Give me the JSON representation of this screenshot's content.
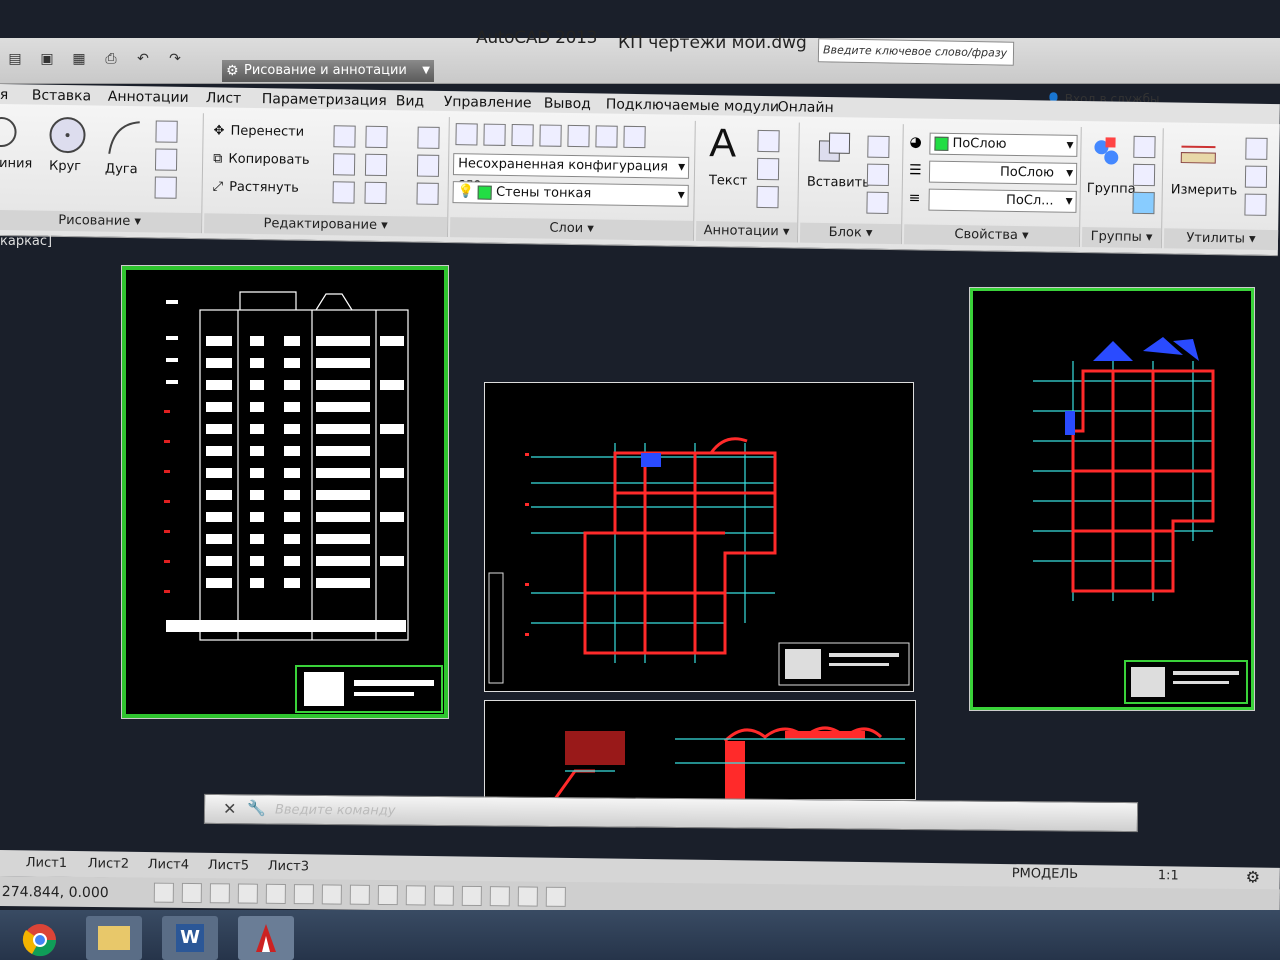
{
  "window": {
    "app_title": "AutoCAD 2013",
    "file_title": "КП чертежи мои.dwg",
    "workspace": "Рисование и аннотации",
    "search_placeholder": "Введите ключевое слово/фразу",
    "signin": "Вход в службы"
  },
  "tabs": [
    "я",
    "Вставка",
    "Аннотации",
    "Лист",
    "Параметризация",
    "Вид",
    "Управление",
    "Вывод",
    "Подключаемые модули",
    "Онлайн"
  ],
  "ribbon": {
    "draw": {
      "title": "Рисование",
      "line": "иния",
      "circle": "Круг",
      "arc": "Дуга"
    },
    "modify": {
      "title": "Редактирование",
      "move": "Перенести",
      "copy": "Копировать",
      "stretch": "Растянуть"
    },
    "layers": {
      "title": "Слои",
      "layer_state": "Несохраненная конфигурация сло",
      "current_layer": "Стены тонкая"
    },
    "annotation": {
      "title": "Аннотации",
      "text": "Текст"
    },
    "block": {
      "title": "Блок",
      "insert": "Вставить"
    },
    "properties": {
      "title": "Свойства",
      "color": "ПоСлою",
      "linetype": "ПоСлою",
      "lineweight": "ПоСл..."
    },
    "groups": {
      "title": "Группы",
      "group": "Группа"
    },
    "utilities": {
      "title": "Утилиты",
      "measure": "Измерить"
    }
  },
  "viewport_label": "каркас]",
  "command": {
    "placeholder": "Введите команду"
  },
  "layout_tabs": [
    "Лист1",
    "Лист2",
    "Лист4",
    "Лист5",
    "Лист3"
  ],
  "status": {
    "coords": "274.844, 0.000",
    "model": "РМОДЕЛЬ",
    "scale": "1:1"
  },
  "colors": {
    "sheet_border": "#2fc42f",
    "plan_red": "#ff2a2a",
    "grid_cyan": "#38e0e0",
    "background": "#1a1f2a"
  }
}
